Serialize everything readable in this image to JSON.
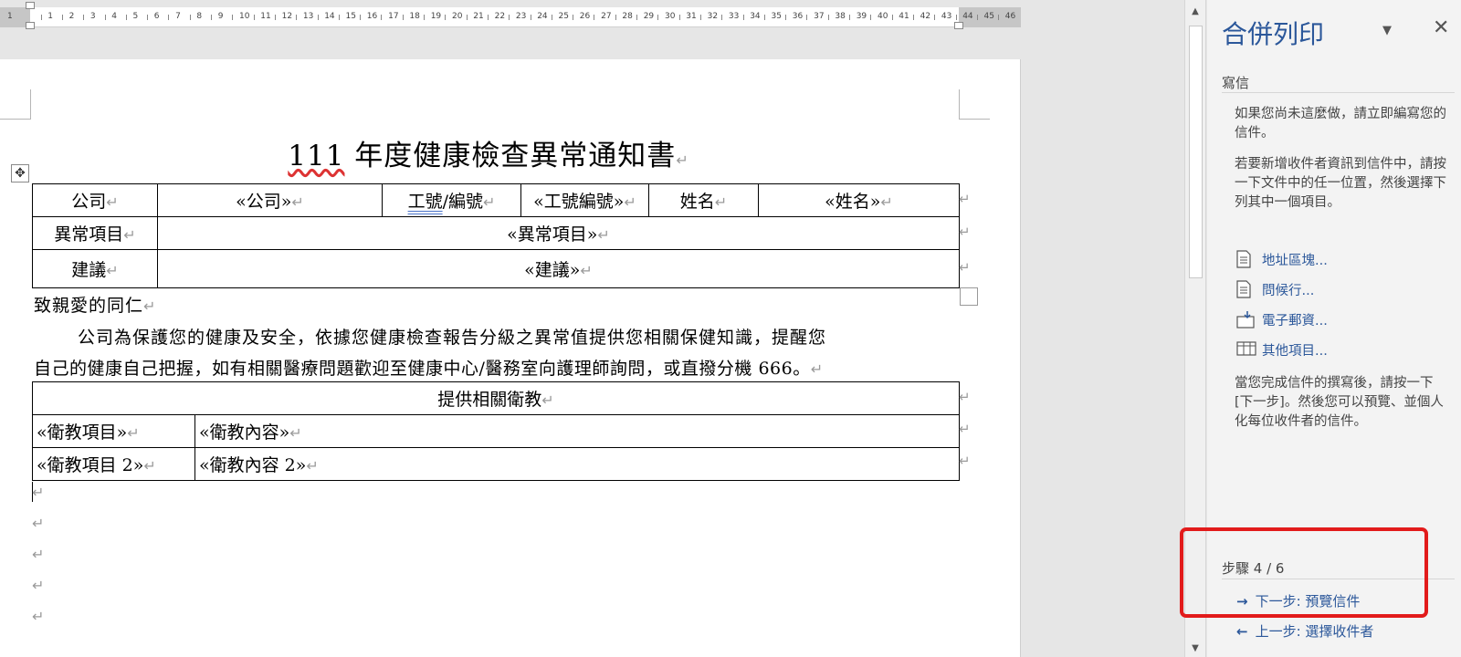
{
  "ruler": {
    "numbers": [
      "1",
      "1",
      "2",
      "3",
      "4",
      "5",
      "6",
      "7",
      "8",
      "9",
      "10",
      "11",
      "12",
      "13",
      "14",
      "15",
      "16",
      "17",
      "18",
      "19",
      "20",
      "21",
      "22",
      "23",
      "24",
      "25",
      "26",
      "27",
      "28",
      "29",
      "30",
      "31",
      "32",
      "33",
      "34",
      "35",
      "36",
      "37",
      "38",
      "39",
      "40",
      "41",
      "42",
      "43",
      "44",
      "45",
      "46"
    ]
  },
  "document": {
    "title_part1": "111",
    "title_part2": " 年度健康檢查異常通知書",
    "para_mark": "↵",
    "table1": {
      "company_label": "公司",
      "company_field": "«公司»",
      "id_label_a": "工號",
      "id_label_b": "/編號",
      "id_field": "«工號編號»",
      "name_label": "姓名",
      "name_field": "«姓名»",
      "abnormal_label": "異常項目",
      "abnormal_field": "«異常項目»",
      "advice_label": "建議",
      "advice_field": "«建議»"
    },
    "greeting": "致親愛的同仁",
    "body_line1": "公司為保護您的健康及安全，依據您健康檢查報告分級之異常值提供您相關保健知識，提醒您",
    "body_line2": "自己的健康自己把握，如有相關醫療問題歡迎至健康中心/醫務室向護理師詢問，或直撥分機 666。",
    "table2": {
      "header": "提供相關衛教",
      "rows": [
        {
          "item": "«衛教項目»",
          "content": "«衛教內容»"
        },
        {
          "item": "«衛教項目 2»",
          "content": "«衛教內容 2»"
        }
      ]
    }
  },
  "pane": {
    "title": "合併列印",
    "dropdown_icon": "▼",
    "close_icon": "✕",
    "section": "寫信",
    "intro": "如果您尚未這麼做，請立即編寫您的信件。",
    "instruction": "若要新增收件者資訊到信件中，請按一下文件中的任一位置，然後選擇下列其中一個項目。",
    "links": [
      "地址區塊...",
      "問候行...",
      "電子郵資...",
      "其他項目..."
    ],
    "after": "當您完成信件的撰寫後，請按一下 [下一步]。然後您可以預覽、並個人化每位收件者的信件。",
    "step": "步驟 4 / 6",
    "next_label": "下一步: 預覽信件",
    "prev_label": "上一步: 選擇收件者",
    "next_arrow": "→",
    "prev_arrow": "←",
    "accent": "#2b579a",
    "highlight_color": "#e21b1b"
  }
}
